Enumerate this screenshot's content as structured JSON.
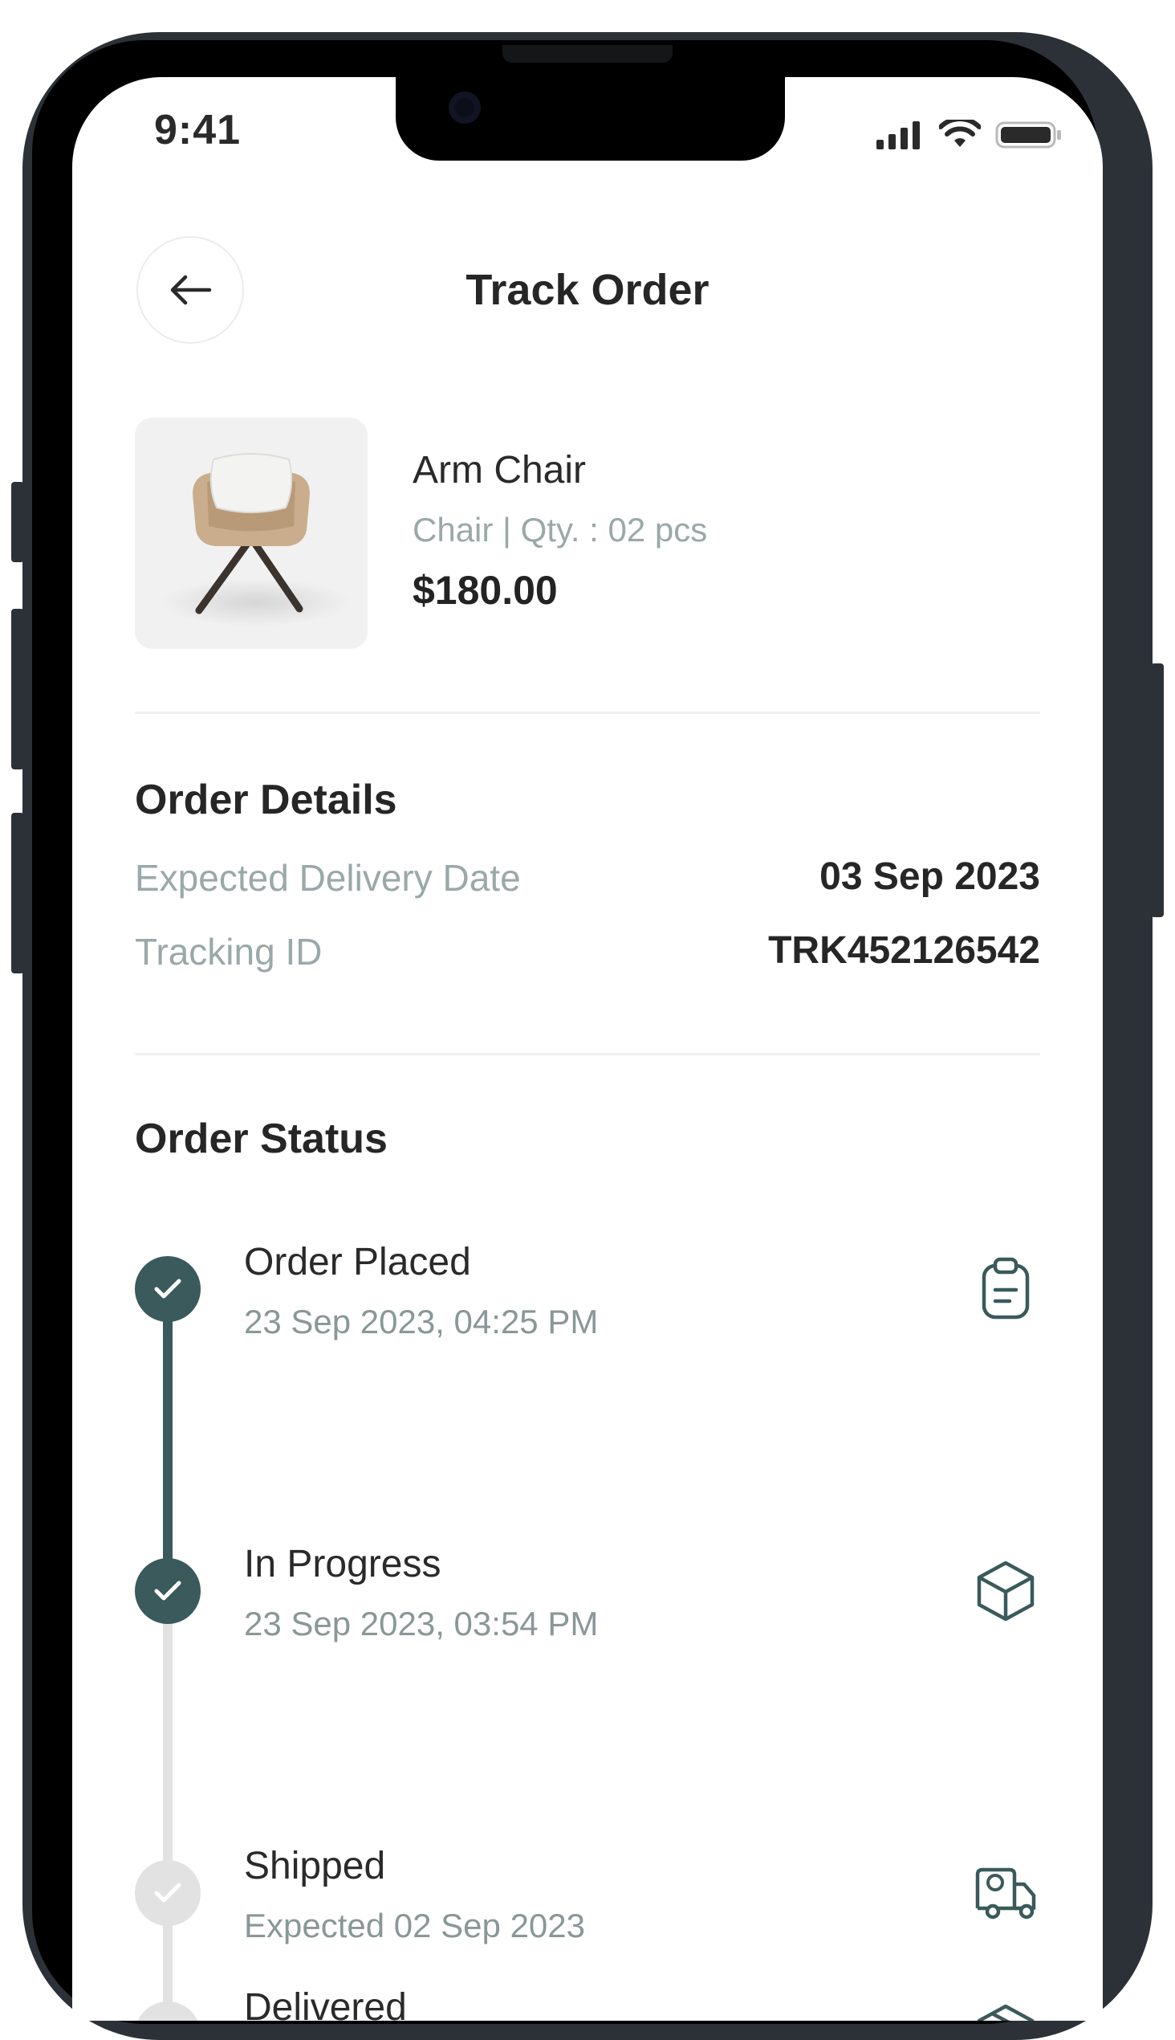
{
  "status_bar": {
    "time": "9:41"
  },
  "header": {
    "title": "Track Order",
    "back_icon": "arrow-left-icon"
  },
  "product": {
    "name": "Arm Chair",
    "meta": "Chair | Qty. : 02 pcs",
    "price": "$180.00"
  },
  "order_details": {
    "title": "Order Details",
    "rows": [
      {
        "label": "Expected Delivery Date",
        "value": "03 Sep 2023"
      },
      {
        "label": "Tracking ID",
        "value": "TRK452126542"
      }
    ]
  },
  "order_status": {
    "title": "Order Status",
    "steps": [
      {
        "title": "Order Placed",
        "subtitle": "23 Sep 2023, 04:25 PM",
        "done": true,
        "icon": "clipboard-icon"
      },
      {
        "title": "In Progress",
        "subtitle": "23 Sep 2023, 03:54 PM",
        "done": true,
        "icon": "box-icon"
      },
      {
        "title": "Shipped",
        "subtitle": "Expected 02 Sep 2023",
        "done": false,
        "icon": "truck-icon"
      },
      {
        "title": "Delivered",
        "subtitle": "",
        "done": false,
        "icon": "package-icon"
      }
    ]
  },
  "colors": {
    "accent": "#3a5a5b",
    "pending": "#e2e2e2",
    "muted_text": "#9aa8a8",
    "frame": "#2b3137"
  }
}
